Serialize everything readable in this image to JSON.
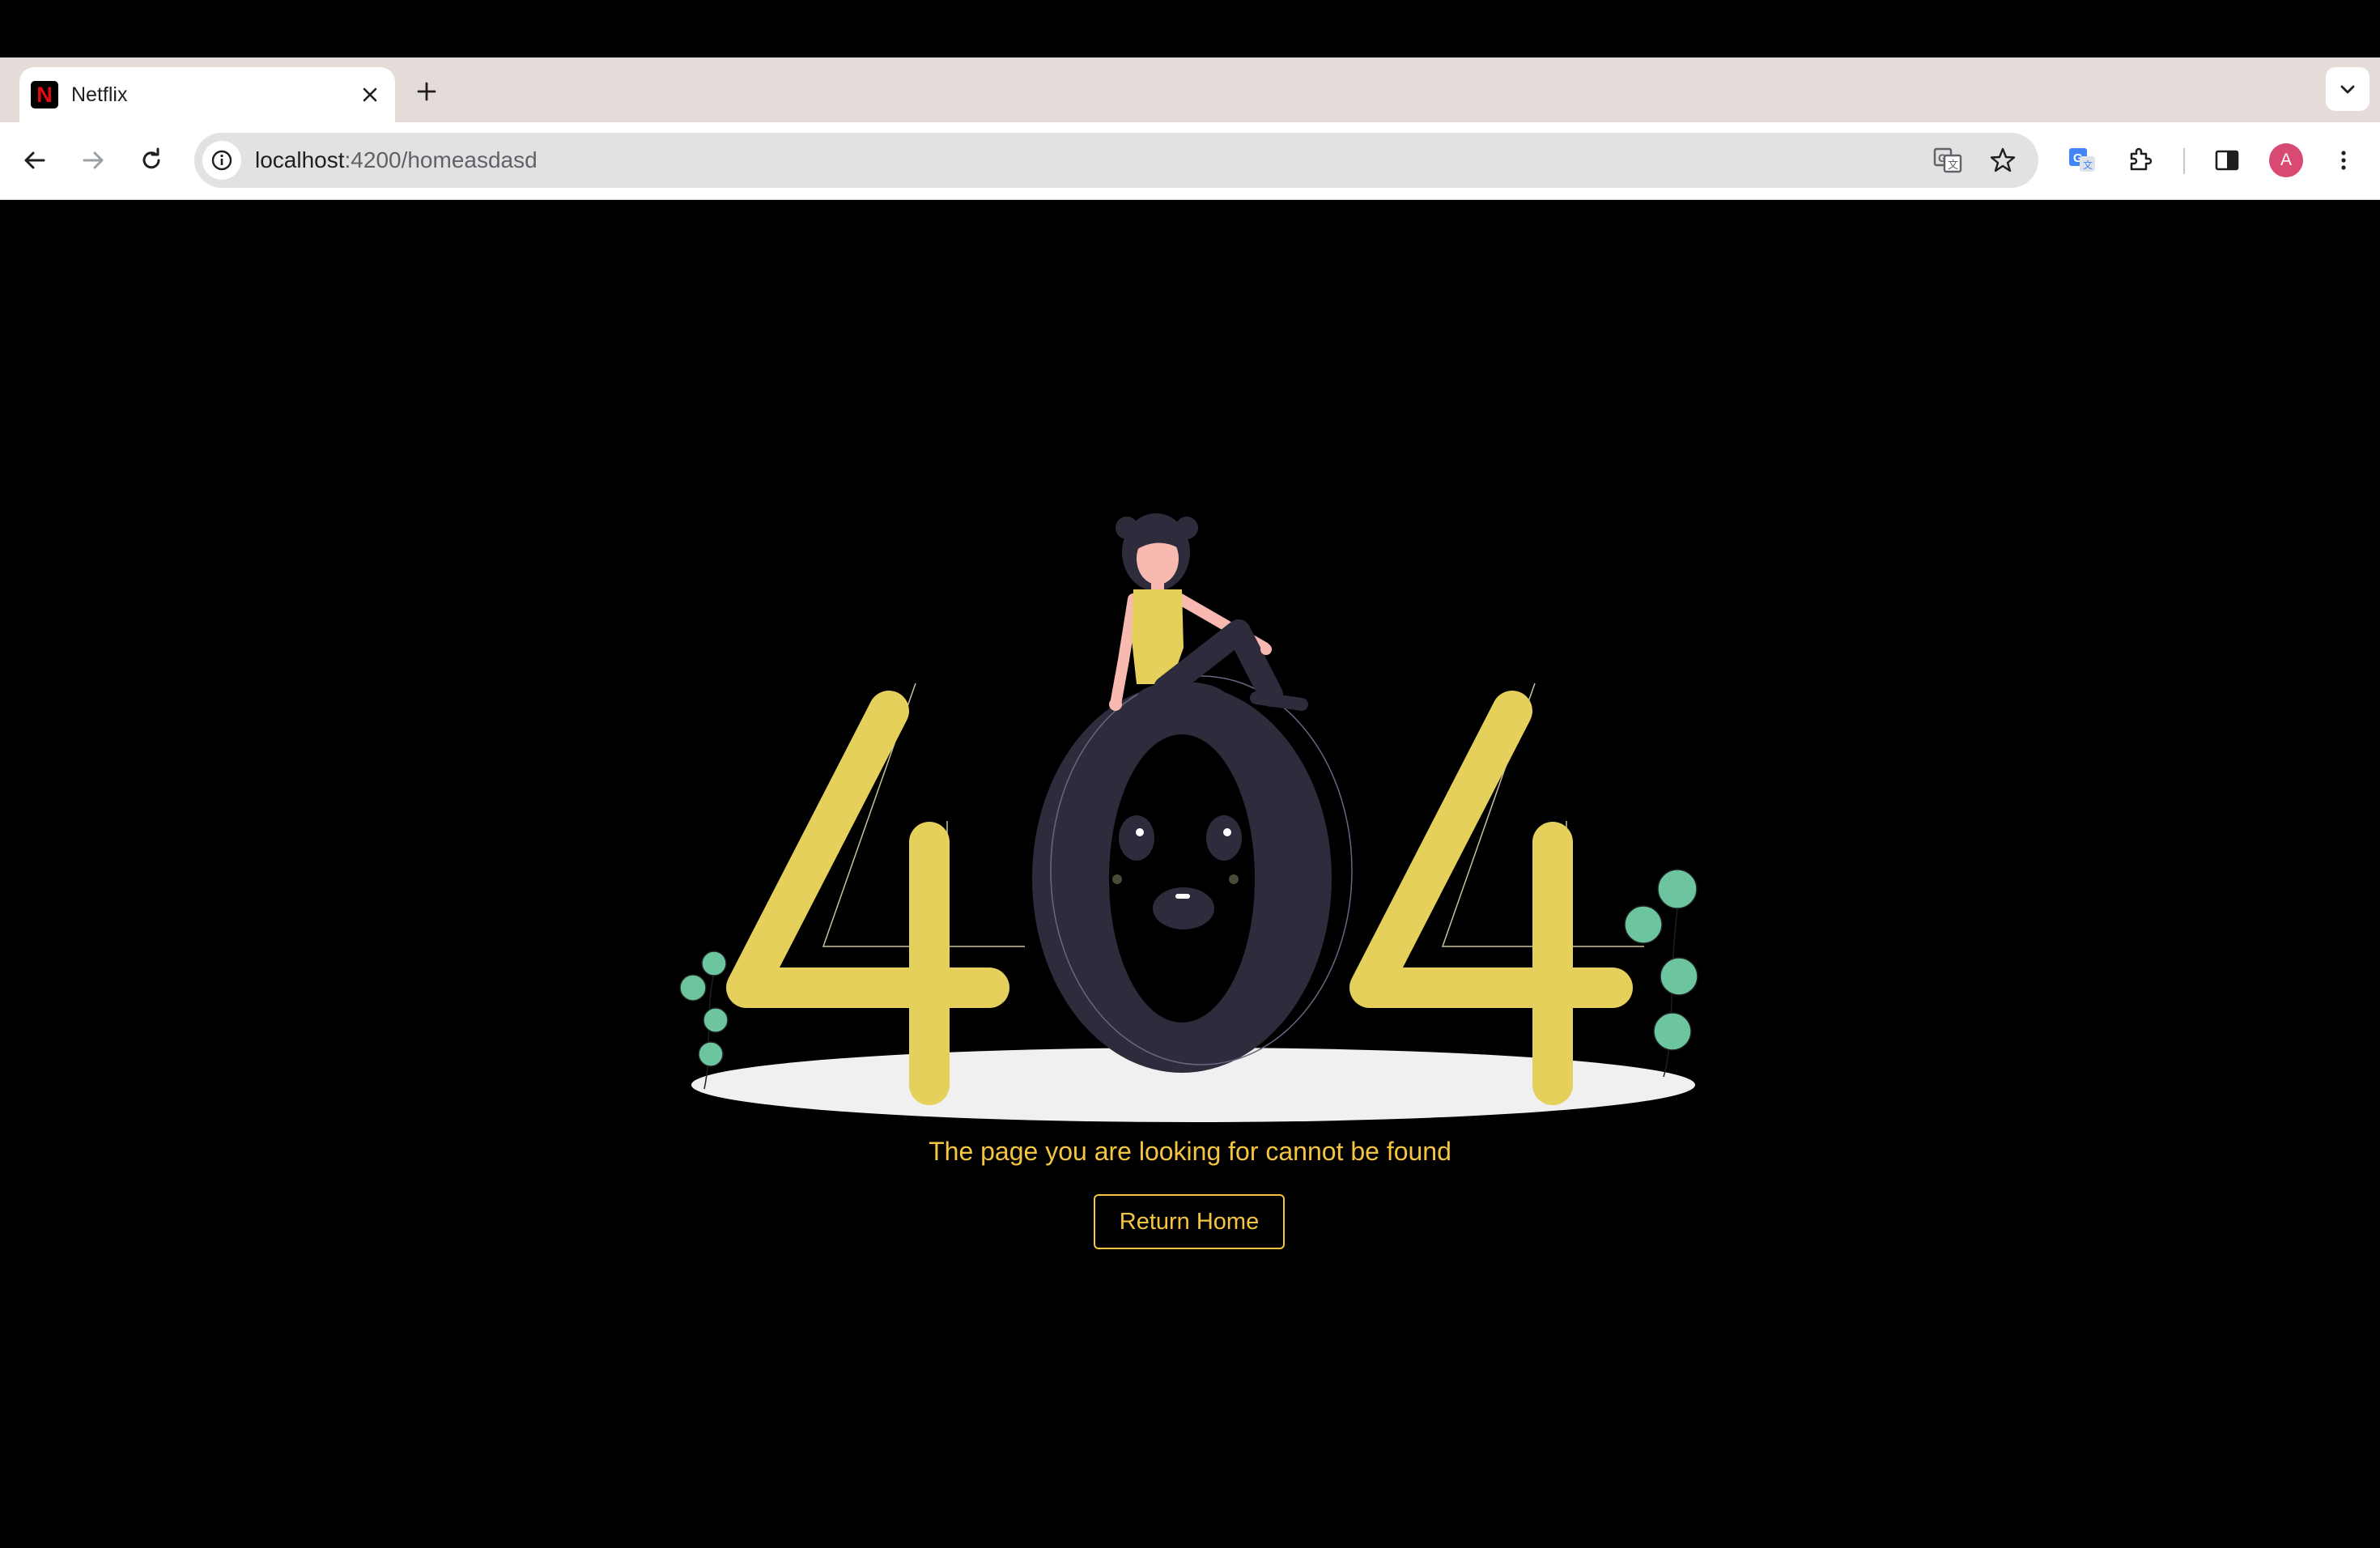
{
  "browser": {
    "tab": {
      "favicon_letter": "N",
      "title": "Netflix",
      "close_icon": "close-icon"
    },
    "new_tab_icon": "plus-icon",
    "tab_search_icon": "chevron-down-icon",
    "address": {
      "host": "localhost",
      "path": ":4200/homeasdasd"
    },
    "profile_initial": "A",
    "colors": {
      "tabstrip": "#e5dcd9",
      "omnibox": "#e2e2e2",
      "avatar": "#d94a73"
    }
  },
  "page": {
    "background": "#000000",
    "accent": "#f5c542",
    "illustration_text": "404",
    "message": "The page you are looking for cannot be found",
    "return_button_label": "Return Home"
  }
}
